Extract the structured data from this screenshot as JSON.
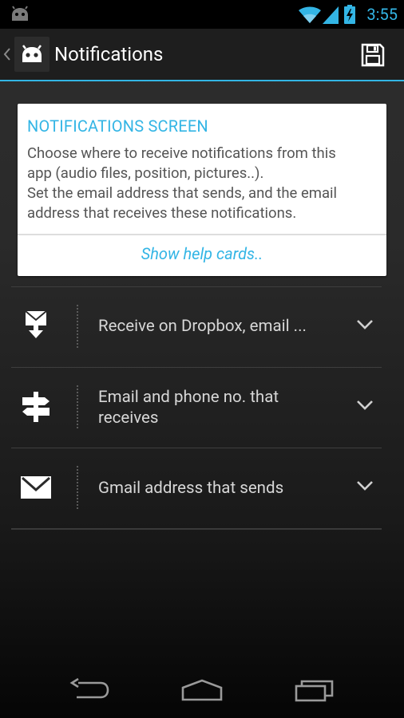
{
  "status_bar": {
    "time": "3:55"
  },
  "action_bar": {
    "title": "Notifications"
  },
  "help_card": {
    "heading": "NOTIFICATIONS SCREEN",
    "body_lines": [
      "Choose where to receive notifications from this",
      "app (audio files, position, pictures..).",
      "Set the email address that sends, and the email",
      "address that receives these notifications."
    ],
    "link": "Show help cards.."
  },
  "settings": [
    {
      "label": "Receive on Dropbox, email ..."
    },
    {
      "label_lines": [
        "Email and phone no. that",
        "receives"
      ]
    },
    {
      "label": "Gmail address that sends"
    }
  ],
  "colors": {
    "accent": "#33b5e5",
    "card_bg": "#ffffff",
    "text_light": "#d7d7d7"
  },
  "icons": {
    "status_app": "android-icon",
    "wifi": "wifi-icon",
    "signal": "signal-icon",
    "battery": "battery-charging-icon",
    "up": "back-chevron-icon",
    "app": "android-app-icon",
    "save": "save-floppy-icon",
    "row1": "mail-download-icon",
    "row2": "signpost-icon",
    "row3": "gmail-envelope-icon",
    "expand": "chevron-down-icon",
    "nav_back": "back-nav-icon",
    "nav_home": "home-nav-icon",
    "nav_recent": "recent-apps-icon"
  }
}
